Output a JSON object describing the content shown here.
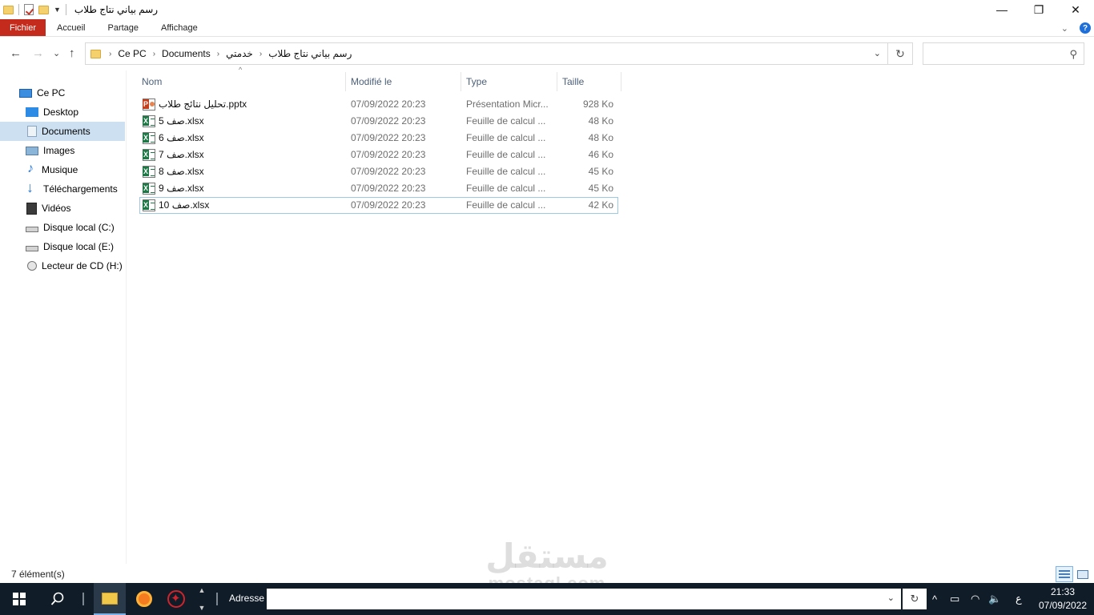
{
  "window": {
    "title": "رسم بياني نتاج طلاب",
    "controls": {
      "minimize": "—",
      "maximize": "❐",
      "close": "✕"
    }
  },
  "ribbon": {
    "tabs": [
      "Fichier",
      "Accueil",
      "Partage",
      "Affichage"
    ],
    "expand_icon": "⌄",
    "help_icon": "?"
  },
  "nav": {
    "back": "←",
    "forward": "→",
    "recent": "⌄",
    "up": "↑",
    "breadcrumbs": [
      "Ce PC",
      "Documents",
      "خدمتي",
      "رسم بياني نتاج طلاب"
    ],
    "crumb_separator": "›",
    "refresh": "↻",
    "search_placeholder": "",
    "search_icon": "⚲"
  },
  "sidebar": {
    "items": [
      {
        "label": "Ce PC",
        "icon": "computer-icon"
      },
      {
        "label": "Desktop",
        "icon": "desktop-icon"
      },
      {
        "label": "Documents",
        "icon": "documents-icon",
        "selected": true
      },
      {
        "label": "Images",
        "icon": "images-icon"
      },
      {
        "label": "Musique",
        "icon": "music-icon"
      },
      {
        "label": "Téléchargements",
        "icon": "downloads-icon"
      },
      {
        "label": "Vidéos",
        "icon": "videos-icon"
      },
      {
        "label": "Disque local (C:)",
        "icon": "drive-icon"
      },
      {
        "label": "Disque local (E:)",
        "icon": "drive-icon"
      },
      {
        "label": "Lecteur de CD (H:)",
        "icon": "cd-drive-icon"
      }
    ]
  },
  "columns": {
    "name": "Nom",
    "modified": "Modifié le",
    "type": "Type",
    "size": "Taille",
    "sort_indicator": "^"
  },
  "files": [
    {
      "name": "تحليل نتائج طلاب.pptx",
      "modified": "07/09/2022 20:23",
      "type": "Présentation Micr...",
      "size": "928 Ko",
      "icon": "powerpoint-icon"
    },
    {
      "name": "صف 5.xlsx",
      "modified": "07/09/2022 20:23",
      "type": "Feuille de calcul ...",
      "size": "48 Ko",
      "icon": "excel-icon"
    },
    {
      "name": "صف 6.xlsx",
      "modified": "07/09/2022 20:23",
      "type": "Feuille de calcul ...",
      "size": "48 Ko",
      "icon": "excel-icon"
    },
    {
      "name": "صف 7.xlsx",
      "modified": "07/09/2022 20:23",
      "type": "Feuille de calcul ...",
      "size": "46 Ko",
      "icon": "excel-icon"
    },
    {
      "name": "صف 8.xlsx",
      "modified": "07/09/2022 20:23",
      "type": "Feuille de calcul ...",
      "size": "45 Ko",
      "icon": "excel-icon"
    },
    {
      "name": "صف 9.xlsx",
      "modified": "07/09/2022 20:23",
      "type": "Feuille de calcul ...",
      "size": "45 Ko",
      "icon": "excel-icon"
    },
    {
      "name": "صف 10.xlsx",
      "modified": "07/09/2022 20:23",
      "type": "Feuille de calcul ...",
      "size": "42 Ko",
      "icon": "excel-icon",
      "focused": true
    }
  ],
  "status": {
    "count": "7 élément(s)"
  },
  "watermark": {
    "main": "مستقل",
    "sub": "mostaql.com"
  },
  "taskbar": {
    "address_label": "Adresse",
    "address_value": "",
    "dropdown": "⌄",
    "refresh": "↻",
    "tray": {
      "chevron": "^",
      "battery": "▭",
      "wifi": "◠",
      "volume": "🔈",
      "language": "ع"
    },
    "clock": {
      "time": "21:33",
      "date": "07/09/2022"
    }
  },
  "colors": {
    "file_tab": "#c42b1c",
    "selection": "#cce0f2",
    "taskbar": "#101c28",
    "excel": "#1d7845",
    "powerpoint": "#c43e1c"
  }
}
